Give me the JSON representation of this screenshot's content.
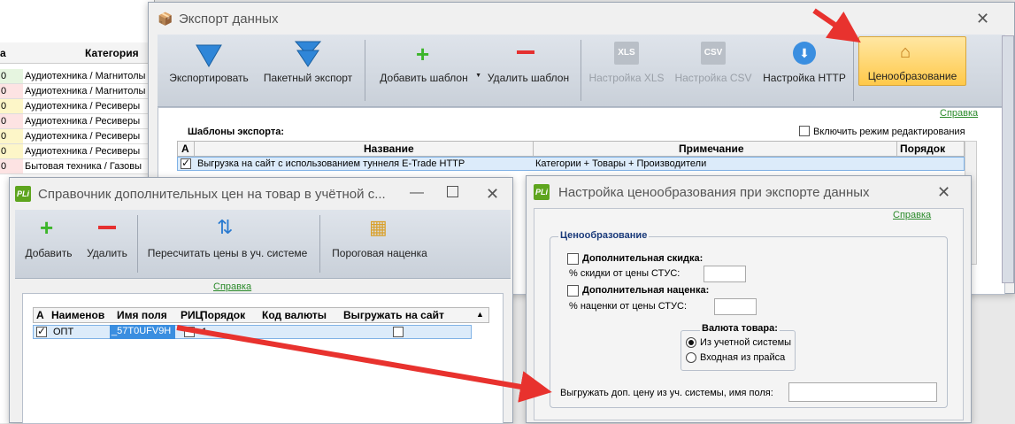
{
  "bg_table": {
    "col1_header": "а",
    "col2_header": "Категория",
    "rows": [
      {
        "c1": "0",
        "cat": "Аудиотехника / Магнитолы",
        "color": "#e6f5e0"
      },
      {
        "c1": "0",
        "cat": "Аудиотехника / Магнитолы",
        "color": "#fde3e3"
      },
      {
        "c1": "0",
        "cat": "Аудиотехника / Ресиверы",
        "color": "#fdf6c8"
      },
      {
        "c1": "0",
        "cat": "Аудиотехника / Ресиверы",
        "color": "#fde3e3"
      },
      {
        "c1": "0",
        "cat": "Аудиотехника / Ресиверы",
        "color": "#fdf6c8"
      },
      {
        "c1": "0",
        "cat": "Аудиотехника / Ресиверы",
        "color": "#fdf6c8"
      },
      {
        "c1": "0",
        "cat": "Бытовая техника / Газовы",
        "color": "#fde3e3"
      }
    ]
  },
  "export_window": {
    "title": "Экспорт данных",
    "toolbar": {
      "export": "Экспортировать",
      "batch_export": "Пакетный экспорт",
      "add_template": "Добавить шаблон",
      "delete_template": "Удалить шаблон",
      "xls_settings": "Настройка XLS",
      "csv_settings": "Настройка CSV",
      "http_settings": "Настройка HTTP",
      "pricing": "Ценообразование",
      "xls_icon_text": "XLS",
      "csv_icon_text": "CSV"
    },
    "help_link": "Справка",
    "templates_label": "Шаблоны экспорта:",
    "edit_mode_label": "Включить режим редактирования",
    "grid_headers": {
      "a": "А",
      "name": "Название",
      "note": "Примечание",
      "order": "Порядок"
    },
    "row1": {
      "name": "Выгрузка на сайт с использованием туннеля E-Trade HTTP",
      "note": "Категории + Товары + Производители"
    }
  },
  "prices_window": {
    "title": "Справочник дополнительных цен на товар в учётной с...",
    "toolbar": {
      "add": "Добавить",
      "delete": "Удалить",
      "recalc": "Пересчитать цены в уч. системе",
      "threshold": "Пороговая наценка"
    },
    "help_link": "Справка",
    "grid_headers": {
      "a": "А",
      "name": "Наименов",
      "field": "Имя поля",
      "ric": "РИЦ",
      "order": "Порядок",
      "currency": "Код валюты",
      "upload": "Выгружать на сайт"
    },
    "row1": {
      "name": "ОПТ",
      "field": "_57T0UFV9H",
      "order": "1"
    },
    "app_icon": "PLi"
  },
  "pricing_window": {
    "title": "Настройка ценообразования при экспорте данных",
    "help_link": "Справка",
    "app_icon": "PLi",
    "group_title": "Ценообразование",
    "extra_discount_label": "Дополнительная скидка:",
    "discount_pct_label": "% скидки от цены СТУС:",
    "extra_markup_label": "Дополнительная наценка:",
    "markup_pct_label": "% наценки от цены СТУС:",
    "currency_title": "Валюта товара:",
    "currency_options": [
      "Из учетной системы",
      "Входная из прайса"
    ],
    "upload_label": "Выгружать доп. цену из уч. системы, имя поля:"
  },
  "colors": {
    "arrow": "#e8322e",
    "highlight": "#ffd56b",
    "link": "#2a8a2a"
  }
}
